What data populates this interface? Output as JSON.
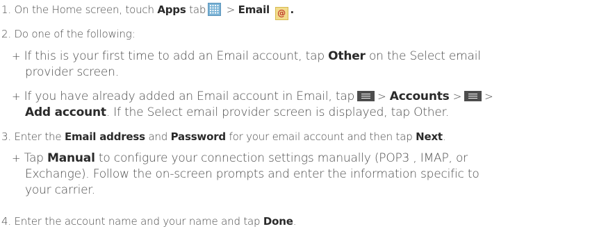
{
  "steps": {
    "s1": {
      "num": "1.",
      "a": "On the Home screen, touch",
      "apps": "Apps",
      "tab": "tab",
      "gt": ">",
      "email": "Email",
      "end": "."
    },
    "s2": {
      "num": "2.",
      "text": "Do one of the following:"
    },
    "b1": {
      "plus": "+",
      "a": "If this is your first time to add an Email account, tap",
      "other": "Other",
      "b": "on the Select email",
      "c": "provider screen."
    },
    "b2": {
      "plus": "+",
      "a": "If you have already added an Email account in Email, tap",
      "gt1": ">",
      "accounts": "Accounts",
      "gt2": ">",
      "gt3": ">",
      "add": "Add account",
      "b": ". If the Select email provider screen is displayed, tap Other."
    },
    "s3": {
      "num": "3.",
      "a": "Enter the",
      "email_address": "Email address",
      "and": "and",
      "password": "Password",
      "b": "for your email account and then tap",
      "next": "Next",
      "end": "."
    },
    "b3": {
      "plus": "+",
      "tap": "Tap",
      "manual": "Manual",
      "a": "to configure your connection settings manually (POP3 , IMAP, or",
      "b": "Exchange). Follow the on-screen prompts and enter the information specific to",
      "c": "your carrier."
    },
    "s4": {
      "num": "4.",
      "a": "Enter the account name and your name and tap",
      "done": "Done",
      "end": "."
    }
  },
  "icons": {
    "apps": "apps-grid-icon",
    "email": "email-at-icon",
    "menu": "menu-icon"
  },
  "colors": {
    "text": "#4a4a4a",
    "bold": "#2a2a2a"
  }
}
